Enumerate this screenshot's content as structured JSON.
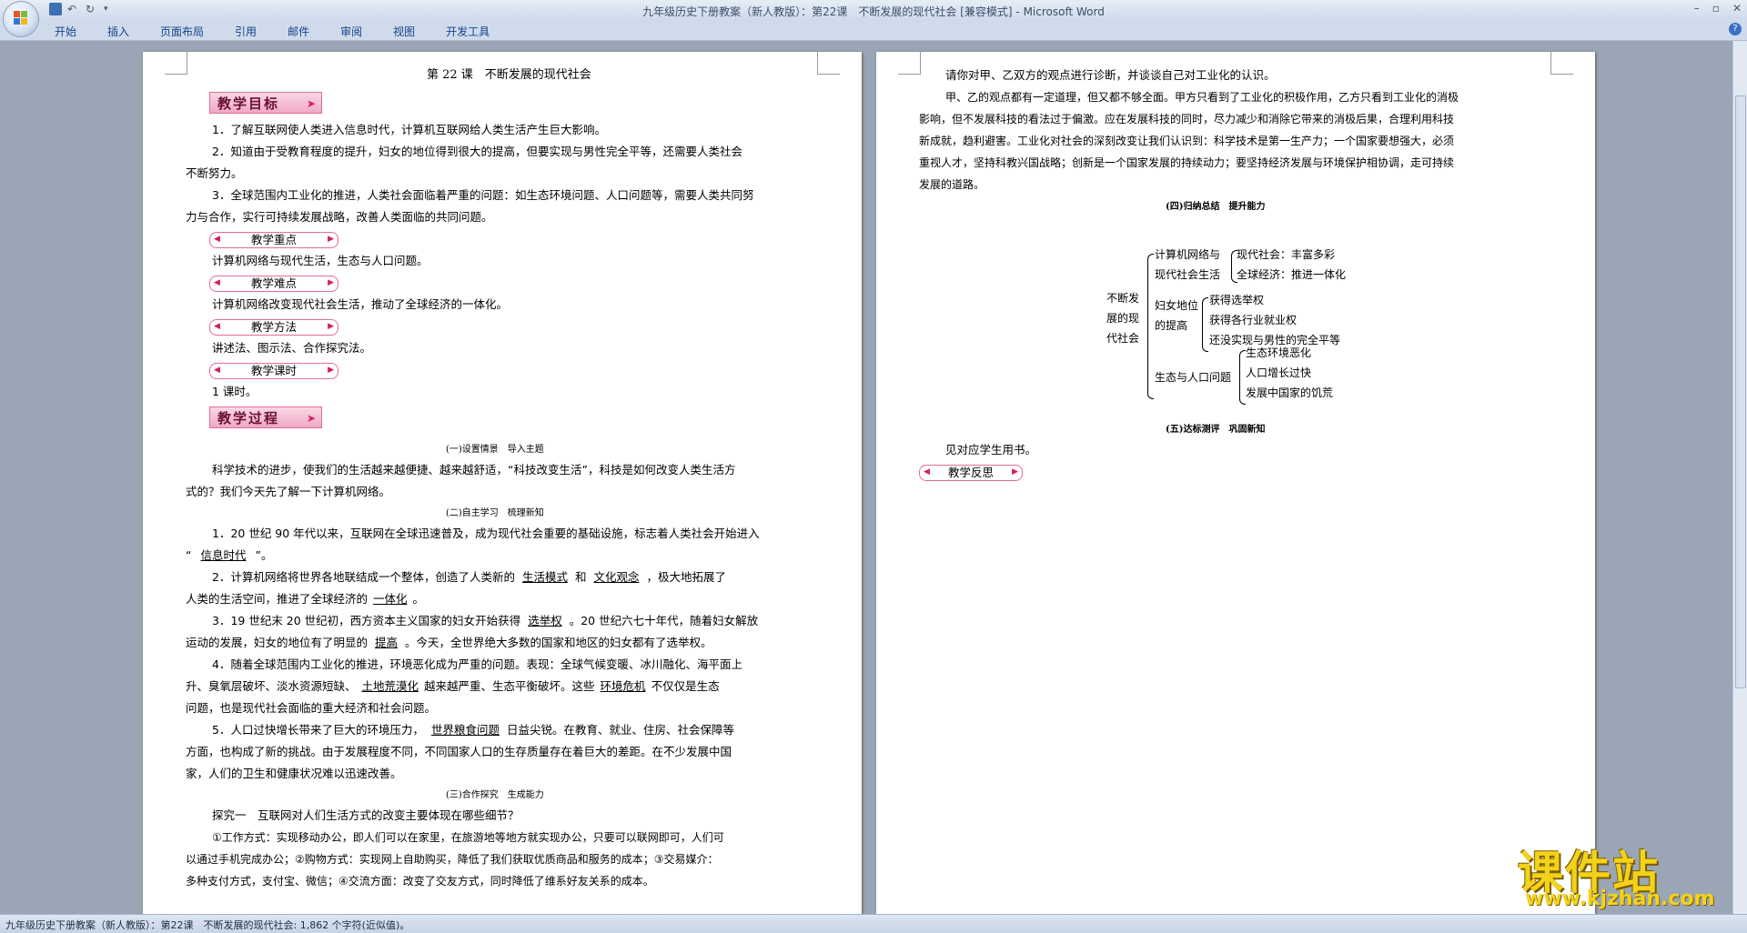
{
  "window": {
    "title": "九年级历史下册教案（新人教版）：第22课　不断发展的现代社会 [兼容模式] - Microsoft Word"
  },
  "ribbon": {
    "tabs": [
      "开始",
      "插入",
      "页面布局",
      "引用",
      "邮件",
      "审阅",
      "视图",
      "开发工具"
    ]
  },
  "page1": {
    "title": "第 22 课　不断发展的现代社会",
    "goal_tag": "教学目标",
    "goals": [
      "1．了解互联网使人类进入信息时代，计算机互联网给人类生活产生巨大影响。",
      "2．知道由于受教育程度的提升，妇女的地位得到很大的提高，但要实现与男性完全平等，还需要人类社会",
      "不断努力。",
      "3．全球范围内工业化的推进，人类社会面临着严重的问题：如生态环境问题、人口问题等，需要人类共同努",
      "力与合作，实行可持续发展战略，改善人类面临的共同问题。"
    ],
    "key_tag": "教学重点",
    "key": "计算机网络与现代生活，生态与人口问题。",
    "difficulty_tag": "教学难点",
    "difficulty": "计算机网络改变现代社会生活，推动了全球经济的一体化。",
    "method_tag": "教学方法",
    "method": "讲述法、图示法、合作探究法。",
    "hours_tag": "教学课时",
    "hours": "1 课时。",
    "process_tag": "教学过程",
    "sec1": "(一)设置情景　导入主题",
    "sec1_text": [
      "科学技术的进步，使我们的生活越来越便捷、越来越舒适，“科技改变生活”，科技是如何改变人类生活方",
      "式的？我们今天先了解一下计算机网络。"
    ],
    "sec2": "(二)自主学习　梳理新知",
    "q1": [
      "1．20 世纪 90 年代以来，互联网在全球迅速普及，成为现代社会重要的基础设施，标志着人类社会开始进入",
      "“",
      "信息时代",
      "”。"
    ],
    "q2": [
      "2．计算机网络将世界各地联结成一个整体，创造了人类新的",
      "生活模式",
      "和",
      "文化观念",
      "，极大地拓展了",
      "人类的生活空间，推进了全球经济的",
      "一体化",
      "。"
    ],
    "q3": [
      "3．19 世纪末 20 世纪初，西方资本主义国家的妇女开始获得",
      "选举权",
      "。20 世纪六七十年代，随着妇女解放",
      "运动的发展，妇女的地位有了明显的",
      "提高",
      "。今天，全世界绝大多数的国家和地区的妇女都有了选举权。"
    ],
    "q4": [
      "4．随着全球范围内工业化的推进，环境恶化成为严重的问题。表现：全球气候变暖、冰川融化、海平面上",
      "升、臭氧层破坏、淡水资源短缺、",
      "土地荒漠化",
      "越来越严重、生态平衡破坏。这些",
      "环境危机",
      "不仅仅是生态",
      "问题，也是现代社会面临的重大经济和社会问题。"
    ],
    "q5": [
      "5．人口过快增长带来了巨大的环境压力，",
      "世界粮食问题",
      "日益尖锐。在教育、就业、住房、社会保障等",
      "方面，也构成了新的挑战。由于发展程度不同，不同国家人口的生存质量存在着巨大的差距。在不少发展中国",
      "家，人们的卫生和健康状况难以迅速改善。"
    ],
    "sec3": "(三)合作探究　生成能力",
    "explore1": "探究一　互联网对人们生活方式的改变主要体现在哪些细节？",
    "explore1_ans": [
      "①工作方式：实现移动办公，即人们可以在家里，在旅游地等地方就实现办公，只要可以联网即可，人们可",
      "以通过手机完成办公；②购物方式：实现网上自助购买，降低了我们获取优质商品和服务的成本；③交易媒介：",
      "多种支付方式，支付宝、微信；④交流方面：改变了交友方式，同时降低了维系好友关系的成本。"
    ]
  },
  "page2": {
    "p1": "请你对甲、乙双方的观点进行诊断，并谈谈自己对工业化的认识。",
    "p2": [
      "甲、乙的观点都有一定道理，但又都不够全面。甲方只看到了工业化的积极作用，乙方只看到工业化的消极",
      "影响，但不发展科技的看法过于偏激。应在发展科技的同时，尽力减少和消除它带来的消极后果，合理利用科技",
      "新成就，趋利避害。工业化对社会的深刻改变让我们认识到：科学技术是第一生产力；一个国家要想强大，必须",
      "重视人才，坚持科教兴国战略；创新是一个国家发展的持续动力；要坚持经济发展与环境保护相协调，走可持续",
      "发展的道路。"
    ],
    "sec4": "(四)归纳总结　提升能力",
    "map": {
      "root": [
        "不断发",
        "展的现",
        "代社会"
      ],
      "b1": [
        "计算机网络与",
        "现代社会生活"
      ],
      "b1_leaves": [
        "现代社会：丰富多彩",
        "全球经济：推进一体化"
      ],
      "b2": [
        "妇女地位",
        "的提高"
      ],
      "b2_leaves": [
        "获得选举权",
        "获得各行业就业权",
        "还没实现与男性的完全平等"
      ],
      "b3": "生态与人口问题",
      "b3_leaves": [
        "生态环境恶化",
        "人口增长过快",
        "发展中国家的饥荒"
      ]
    },
    "sec5": "(五)达标测评　巩固新知",
    "p3": "见对应学生用书。",
    "reflect_tag": "教学反思"
  },
  "status": {
    "text": "九年级历史下册教案（新人教版）：第22课　不断发展的现代社会: 1,862 个字符(近似值)。"
  },
  "watermark": {
    "brand": "课件站",
    "url": "www.kjzhan.com"
  },
  "colors": {
    "tag_pink": "#f0a8c4",
    "tag_border": "#e46c9b",
    "watermark": "#f3d31a",
    "ribbon": "#cfdbeb"
  }
}
